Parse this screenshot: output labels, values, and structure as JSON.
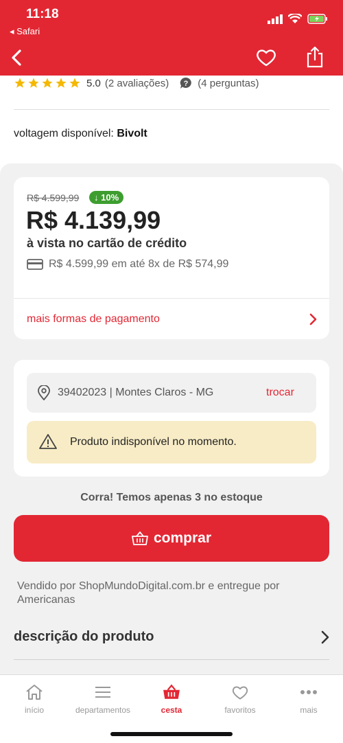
{
  "status": {
    "time": "11:18",
    "back_app": "◂ Safari"
  },
  "product": {
    "rating": "5.0",
    "reviews": "(2 avaliações)",
    "questions": "(4 perguntas)",
    "voltage_label": "voltagem disponível:",
    "voltage_value": "Bivolt"
  },
  "pricing": {
    "old_price": "R$ 4.599,99",
    "discount": "↓ 10%",
    "price": "R$ 4.139,99",
    "price_note": "à vista no cartão de crédito",
    "installments": "R$ 4.599,99 em até 8x de R$ 574,99",
    "more_payment": "mais formas de pagamento"
  },
  "shipping": {
    "cep": "39402023 | Montes Claros - MG",
    "change": "trocar",
    "unavailable": "Produto indisponível no momento."
  },
  "stock_note": "Corra! Temos apenas 3 no estoque",
  "buy_label": "comprar",
  "seller_note": "Vendido por ShopMundoDigital.com.br e entregue por Americanas",
  "description_label": "descrição do produto",
  "tabs": [
    {
      "label": "início",
      "icon": "home-icon"
    },
    {
      "label": "departamentos",
      "icon": "menu-icon"
    },
    {
      "label": "cesta",
      "icon": "basket-icon"
    },
    {
      "label": "favoritos",
      "icon": "heart-icon"
    },
    {
      "label": "mais",
      "icon": "more-icon"
    }
  ],
  "colors": {
    "brand_red": "#e22733",
    "discount_green": "#3d9e2f",
    "warning_bg": "#f8ecc6"
  }
}
